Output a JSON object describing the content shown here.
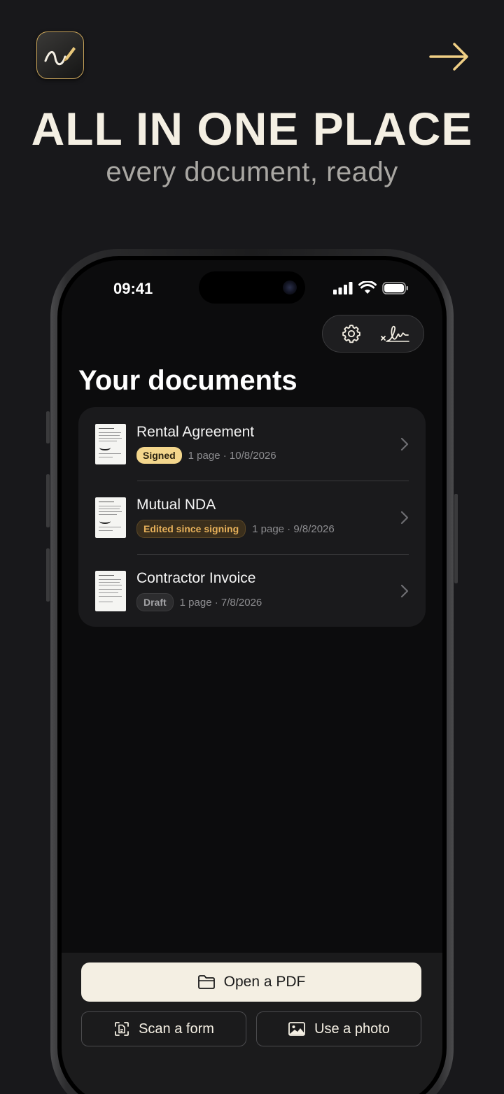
{
  "header": {
    "headline": "ALL IN ONE PLACE",
    "subline": "every document, ready",
    "app_icon": "signature-pen-icon",
    "next_icon": "arrow-right-icon"
  },
  "status_bar": {
    "time": "09:41"
  },
  "toolbar": {
    "settings_icon": "gear-icon",
    "signature_icon": "signature-icon"
  },
  "main": {
    "title": "Your documents",
    "documents": [
      {
        "name": "Rental Agreement",
        "status": "Signed",
        "meta": "1 page · 10/8/2026"
      },
      {
        "name": "Mutual NDA",
        "status": "Edited since signing",
        "meta": "1 page · 9/8/2026"
      },
      {
        "name": "Contractor Invoice",
        "status": "Draft",
        "meta": "1 page · 7/8/2026"
      }
    ]
  },
  "actions": {
    "open_pdf": "Open a PDF",
    "scan_form": "Scan a form",
    "use_photo": "Use a photo"
  },
  "colors": {
    "background": "#18181b",
    "accent": "#f4efe3",
    "gold": "#e8c77a",
    "signed_badge": "#f3d68c",
    "edited_badge_text": "#e6b05a"
  }
}
